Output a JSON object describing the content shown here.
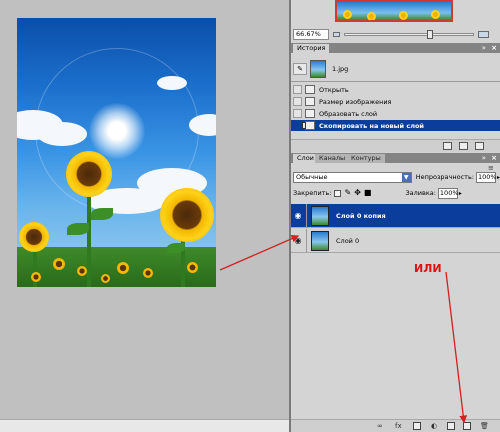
{
  "navigator": {
    "zoom_value": "66.67%",
    "zoom_level_percent": 66.67
  },
  "history": {
    "tab_label": "История",
    "snapshot_label": "1.jpg",
    "items": [
      {
        "label": "Открыть"
      },
      {
        "label": "Размер изображения"
      },
      {
        "label": "Образовать слой"
      },
      {
        "label": "Скопировать на новый слой"
      }
    ]
  },
  "layers": {
    "tabs": [
      {
        "label": "Слои"
      },
      {
        "label": "Каналы"
      },
      {
        "label": "Контуры"
      }
    ],
    "blend_mode": "Обычные",
    "opacity_label": "Непрозрачность:",
    "opacity_value": "100%",
    "lock_label": "Закрепить:",
    "fill_label": "Заливка:",
    "fill_value": "100%",
    "items": [
      {
        "name": "Слой 0 копия"
      },
      {
        "name": "Слой 0"
      }
    ]
  },
  "annotation": {
    "text": "ИЛИ",
    "color": "#e01010"
  },
  "colors": {
    "selection": "#0a3d9c",
    "panel_bg": "#d4d4d4",
    "canvas_bg": "#c0c0c0"
  }
}
